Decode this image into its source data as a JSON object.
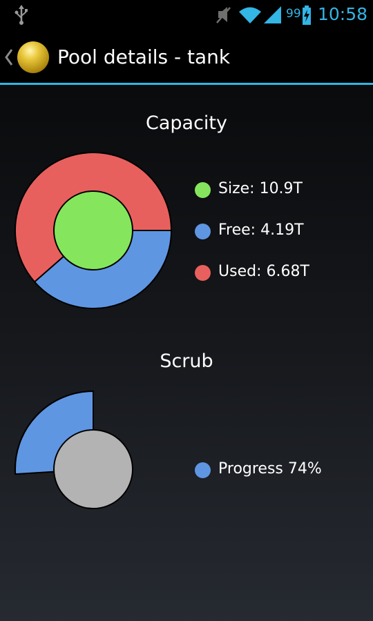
{
  "status_bar": {
    "battery_percent": "99",
    "time": "10:58",
    "icons": [
      "usb-icon",
      "mute-icon",
      "wifi-icon",
      "signal-icon",
      "battery-charging-icon"
    ]
  },
  "action_bar": {
    "title": "Pool details - tank",
    "icons": [
      "back-chevron-icon",
      "app-icon"
    ]
  },
  "colors": {
    "accent": "#33b5e5",
    "size": "#85e65d",
    "free": "#5f96e2",
    "used": "#e8605e",
    "scrub_remaining": "#b3b3b3",
    "outline": "#000000"
  },
  "capacity": {
    "title": "Capacity",
    "legend": [
      {
        "label": "Size: 10.9T",
        "color": "#85e65d"
      },
      {
        "label": "Free: 4.19T",
        "color": "#5f96e2"
      },
      {
        "label": "Used: 6.68T",
        "color": "#e8605e"
      }
    ]
  },
  "scrub": {
    "title": "Scrub",
    "legend": [
      {
        "label": "Progress 74%",
        "color": "#5f96e2"
      }
    ]
  },
  "chart_data": [
    {
      "type": "pie",
      "title": "Capacity",
      "center_value": {
        "name": "Size",
        "value": 10.9,
        "unit": "T"
      },
      "slices": [
        {
          "name": "Free",
          "value": 4.19,
          "unit": "T"
        },
        {
          "name": "Used",
          "value": 6.68,
          "unit": "T"
        }
      ]
    },
    {
      "type": "pie",
      "title": "Scrub",
      "slices": [
        {
          "name": "Progress",
          "value": 74,
          "unit": "%"
        }
      ],
      "total": 100
    }
  ]
}
